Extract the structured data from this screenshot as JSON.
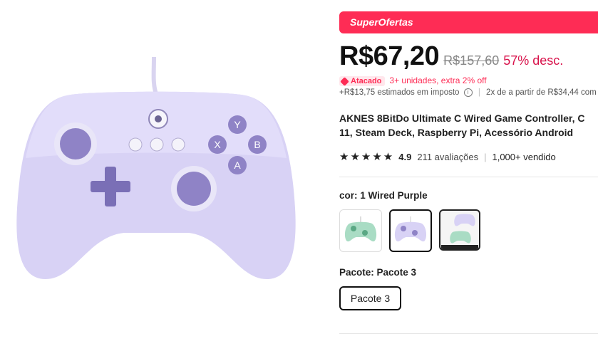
{
  "banner": {
    "label": "SuperOfertas",
    "color": "#fe2c55"
  },
  "price": {
    "current": "R$67,20",
    "original": "R$157,60",
    "discount": "57% desc."
  },
  "wholesale": {
    "tag": "Atacado",
    "text": "3+ unidades, extra 2% off"
  },
  "tax": {
    "estimate": "+R$13,75 estimados em imposto",
    "installments": "2x de a partir de R$34,44 com"
  },
  "product": {
    "title_line1": "AKNES 8BitDo Ultimate C Wired Game Controller, C",
    "title_line2": "11, Steam Deck, Raspberry Pi, Acessório Android",
    "rating": "4.9",
    "stars": "★★★★★",
    "reviews": "211 avaliações",
    "sold": "1,000+ vendido"
  },
  "variant": {
    "color_label": "cor: 1 Wired Purple",
    "options": [
      "green",
      "purple",
      "combo"
    ],
    "selected": "purple"
  },
  "package": {
    "label": "Pacote: Pacote 3",
    "option": "Pacote 3"
  }
}
